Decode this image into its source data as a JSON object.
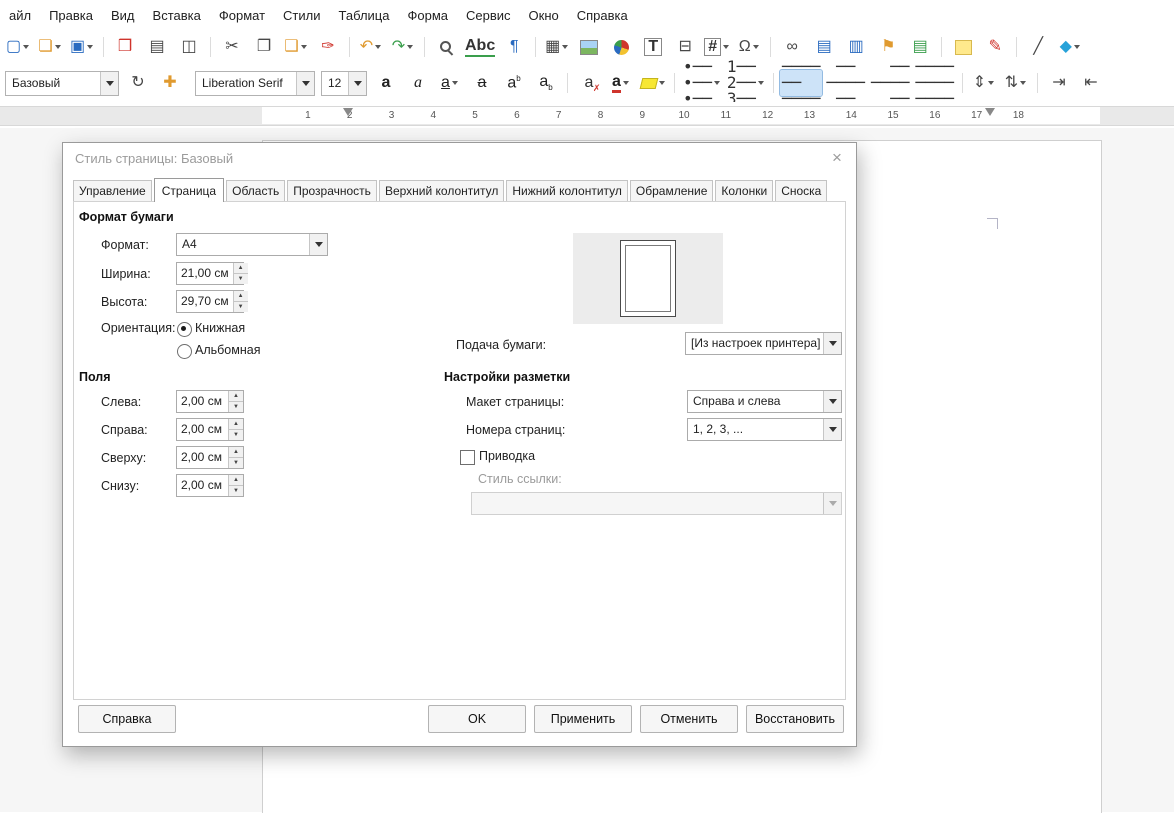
{
  "menubar": {
    "items": [
      {
        "name": "menu-file",
        "label": "айл"
      },
      {
        "name": "menu-edit",
        "label": "Правка"
      },
      {
        "name": "menu-view",
        "label": "Вид"
      },
      {
        "name": "menu-insert",
        "label": "Вставка"
      },
      {
        "name": "menu-format",
        "label": "Формат"
      },
      {
        "name": "menu-styles",
        "label": "Стили"
      },
      {
        "name": "menu-table",
        "label": "Таблица"
      },
      {
        "name": "menu-form",
        "label": "Форма"
      },
      {
        "name": "menu-tools",
        "label": "Сервис"
      },
      {
        "name": "menu-window",
        "label": "Окно"
      },
      {
        "name": "menu-help",
        "label": "Справка"
      }
    ]
  },
  "standard_toolbar": {
    "items": [
      {
        "name": "new-document-icon",
        "glyph": "▢",
        "cls": "c-blue",
        "dd": "has-dd"
      },
      {
        "name": "open-icon",
        "glyph": "❏",
        "cls": "c-amber",
        "dd": "has-dd"
      },
      {
        "name": "save-icon",
        "glyph": "▣",
        "cls": "c-blue",
        "dd": "has-dd"
      },
      {
        "name": "separator",
        "cls_outer": "sep",
        "interactable": false
      },
      {
        "name": "export-pdf-icon",
        "glyph": "❒",
        "cls": "c-red"
      },
      {
        "name": "print-icon",
        "glyph": "▤",
        "cls": "c-dark"
      },
      {
        "name": "print-preview-icon",
        "glyph": "◫",
        "cls": "c-dark"
      },
      {
        "name": "separator",
        "cls_outer": "sep",
        "interactable": false
      },
      {
        "name": "cut-icon",
        "glyph": "✂",
        "cls": "c-dark"
      },
      {
        "name": "copy-icon",
        "glyph": "❐",
        "cls": "c-dark"
      },
      {
        "name": "paste-icon",
        "glyph": "❑",
        "cls": "c-amber",
        "dd": "has-dd"
      },
      {
        "name": "clone-formatting-icon",
        "glyph": "✑",
        "cls": "c-red"
      },
      {
        "name": "separator",
        "cls_outer": "sep",
        "interactable": false
      },
      {
        "name": "undo-icon",
        "glyph": "↶",
        "cls": "c-amber",
        "dd": "has-dd"
      },
      {
        "name": "redo-icon",
        "glyph": "↷",
        "cls": "c-green",
        "dd": "has-dd"
      },
      {
        "name": "separator",
        "cls_outer": "sep",
        "interactable": false
      },
      {
        "name": "find-replace-icon",
        "glyph": "",
        "cls": "ic-magnifier"
      },
      {
        "name": "spellcheck-icon",
        "glyph": "Abc",
        "cls": "ic-spelling"
      },
      {
        "name": "formatting-marks-icon",
        "glyph": "¶",
        "cls": "c-blue"
      },
      {
        "name": "separator",
        "cls_outer": "sep",
        "interactable": false
      },
      {
        "name": "insert-table-icon",
        "glyph": "▦",
        "cls": "c-dark",
        "dd": "has-dd"
      },
      {
        "name": "insert-image-icon",
        "glyph": "",
        "cls": "ic-image"
      },
      {
        "name": "insert-chart-icon",
        "glyph": "",
        "cls": "ic-pie"
      },
      {
        "name": "insert-textbox-icon",
        "glyph": "T",
        "cls": "ic-boxed"
      },
      {
        "name": "page-break-icon",
        "glyph": "⊟",
        "cls": "c-dark"
      },
      {
        "name": "insert-field-icon",
        "glyph": "#",
        "cls": "ic-boxed",
        "dd": "has-dd"
      },
      {
        "name": "special-character-icon",
        "glyph": "Ω",
        "cls": "c-dark",
        "dd": "has-dd"
      },
      {
        "name": "separator",
        "cls_outer": "sep",
        "interactable": false
      },
      {
        "name": "insert-hyperlink-icon",
        "glyph": "∞",
        "cls": "c-dark"
      },
      {
        "name": "insert-footnote-icon",
        "glyph": "▤",
        "cls": "c-blue"
      },
      {
        "name": "insert-endnote-icon",
        "glyph": "▥",
        "cls": "c-blue"
      },
      {
        "name": "insert-bookmark-icon",
        "glyph": "⚑",
        "cls": "c-amber"
      },
      {
        "name": "cross-reference-icon",
        "glyph": "▤",
        "cls": "c-green"
      },
      {
        "name": "separator",
        "cls_outer": "sep",
        "interactable": false
      },
      {
        "name": "insert-comment-icon",
        "glyph": "",
        "cls": "ic-note"
      },
      {
        "name": "track-changes-icon",
        "glyph": "✎",
        "cls": "c-red"
      },
      {
        "name": "separator",
        "cls_outer": "sep",
        "interactable": false
      },
      {
        "name": "insert-line-icon",
        "glyph": "╱",
        "cls": "c-dark"
      },
      {
        "name": "basic-shapes-icon",
        "glyph": "◆",
        "cls": "c-cyan",
        "dd": "has-dd"
      }
    ]
  },
  "formatting_toolbar": {
    "style_combo": {
      "value": "Базовый"
    },
    "font_combo": {
      "value": "Liberation Serif"
    },
    "size_combo": {
      "value": "12"
    },
    "style_icons": [
      {
        "name": "update-style-icon",
        "glyph": "↻",
        "cls": "c-dark"
      },
      {
        "name": "new-style-icon",
        "glyph": "✚",
        "cls": "c-amber"
      }
    ],
    "items": [
      {
        "name": "bold-icon",
        "glyph": "а",
        "cls": "ic-bold"
      },
      {
        "name": "italic-icon",
        "glyph": "а",
        "cls": "ic-italic"
      },
      {
        "name": "underline-icon",
        "glyph": "а",
        "cls": "ic-underline",
        "dd": "has-dd"
      },
      {
        "name": "strikethrough-icon",
        "glyph": "а",
        "cls": "ic-strike"
      },
      {
        "name": "superscript-icon",
        "glyph": "а",
        "cls": "ic-sup"
      },
      {
        "name": "subscript-icon",
        "glyph": "а",
        "cls": "ic-sub"
      },
      {
        "name": "separator",
        "cls_outer": "sep",
        "interactable": false
      },
      {
        "name": "clear-formatting-icon",
        "glyph": "а",
        "cls": "ic-clear"
      },
      {
        "name": "font-color-icon",
        "glyph": "а",
        "cls": "ic-fontcolor",
        "dd": "has-dd"
      },
      {
        "name": "highlight-color-icon",
        "glyph": "",
        "cls": "ic-highlight",
        "dd": "has-dd"
      },
      {
        "name": "separator",
        "cls_outer": "sep",
        "interactable": false
      },
      {
        "name": "bullet-list-icon",
        "glyph": "•──\n•──\n•──",
        "cls": "ic-lines",
        "dd": "has-dd"
      },
      {
        "name": "numbered-list-icon",
        "glyph": "1──\n2──\n3──",
        "cls": "ic-lines",
        "dd": "has-dd"
      },
      {
        "name": "separator",
        "cls_outer": "sep",
        "interactable": false
      },
      {
        "name": "align-left-icon",
        "glyph": "────\n──\n────",
        "cls": "ic-lines",
        "cls_outer": "active"
      },
      {
        "name": "align-center-icon",
        "glyph": " ── \n────\n ── ",
        "cls": "ic-lines"
      },
      {
        "name": "align-right-icon",
        "glyph": "  ──\n────\n  ──",
        "cls": "ic-lines"
      },
      {
        "name": "justify-icon",
        "glyph": "────\n────\n────",
        "cls": "ic-lines"
      },
      {
        "name": "separator",
        "cls_outer": "sep",
        "interactable": false
      },
      {
        "name": "line-spacing-icon",
        "glyph": "⇕",
        "cls": "c-dark",
        "dd": "has-dd"
      },
      {
        "name": "paragraph-spacing-icon",
        "glyph": "⇅",
        "cls": "c-dark",
        "dd": "has-dd"
      },
      {
        "name": "separator",
        "cls_outer": "sep",
        "interactable": false
      },
      {
        "name": "increase-indent-icon",
        "glyph": "⇥",
        "cls": "c-dark"
      },
      {
        "name": "decrease-indent-icon",
        "glyph": "⇤",
        "cls": "c-dark"
      }
    ]
  },
  "ruler": {
    "numbers": [
      "1",
      "2",
      "3",
      "4",
      "5",
      "6",
      "7",
      "8",
      "9",
      "10",
      "11",
      "12",
      "13",
      "14",
      "15",
      "16",
      "17",
      "18"
    ]
  },
  "dialog": {
    "title": "Стиль страницы: Базовый",
    "close_icon": "×",
    "tabs": [
      {
        "name": "tab-organizer",
        "label": "Управление"
      },
      {
        "name": "tab-page",
        "label": "Страница",
        "cls": "active"
      },
      {
        "name": "tab-area",
        "label": "Область"
      },
      {
        "name": "tab-transparency",
        "label": "Прозрачность"
      },
      {
        "name": "tab-header",
        "label": "Верхний колонтитул"
      },
      {
        "name": "tab-footer",
        "label": "Нижний колонтитул"
      },
      {
        "name": "tab-borders",
        "label": "Обрамление"
      },
      {
        "name": "tab-columns",
        "label": "Колонки"
      },
      {
        "name": "tab-footnote",
        "label": "Сноска"
      }
    ],
    "paper_format": {
      "group_label": "Формат бумаги",
      "format_label": "Формат:",
      "format_value": "A4",
      "width_label": "Ширина:",
      "width_value": "21,00 см",
      "height_label": "Высота:",
      "height_value": "29,70 см",
      "orientation_label": "Ориентация:",
      "portrait_label": "Книжная",
      "landscape_label": "Альбомная",
      "paper_tray_label": "Подача бумаги:",
      "paper_tray_value": "[Из настроек принтера]"
    },
    "margins": {
      "group_label": "Поля",
      "left_label": "Слева:",
      "left_value": "2,00 см",
      "right_label": "Справа:",
      "right_value": "2,00 см",
      "top_label": "Сверху:",
      "top_value": "2,00 см",
      "bottom_label": "Снизу:",
      "bottom_value": "2,00 см"
    },
    "layout": {
      "group_label": "Настройки разметки",
      "page_layout_label": "Макет страницы:",
      "page_layout_value": "Справа и слева",
      "page_numbers_label": "Номера страниц:",
      "page_numbers_value": "1, 2, 3, ...",
      "register_true_label": "Приводка",
      "reference_style_label": "Стиль ссылки:",
      "reference_style_value": ""
    },
    "buttons": {
      "help": "Справка",
      "ok": "OK",
      "apply": "Применить",
      "cancel": "Отменить",
      "reset": "Восстановить"
    }
  }
}
